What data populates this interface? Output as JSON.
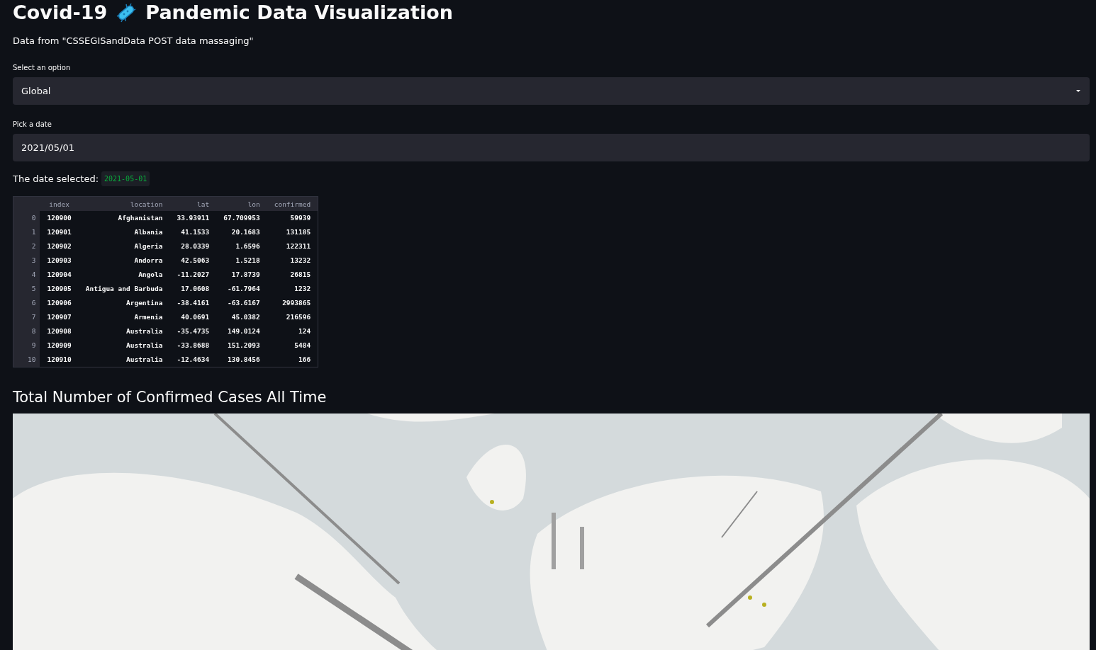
{
  "title": {
    "before_icon": "Covid-19",
    "after_icon": "Pandemic Data Visualization"
  },
  "source_note": "Data from \"CSSEGISandData POST data massaging\"",
  "select": {
    "label": "Select an option",
    "value": "Global"
  },
  "date_input": {
    "label": "Pick a date",
    "value": "2021/05/01"
  },
  "date_selected": {
    "label": "The date selected:",
    "value": "2021-05-01"
  },
  "table": {
    "columns": [
      "index",
      "location",
      "lat",
      "lon",
      "confirmed"
    ],
    "rows": [
      {
        "row_index": "0",
        "cells": [
          "120900",
          "Afghanistan",
          "33.93911",
          "67.709953",
          "59939"
        ]
      },
      {
        "row_index": "1",
        "cells": [
          "120901",
          "Albania",
          "41.1533",
          "20.1683",
          "131185"
        ]
      },
      {
        "row_index": "2",
        "cells": [
          "120902",
          "Algeria",
          "28.0339",
          "1.6596",
          "122311"
        ]
      },
      {
        "row_index": "3",
        "cells": [
          "120903",
          "Andorra",
          "42.5063",
          "1.5218",
          "13232"
        ]
      },
      {
        "row_index": "4",
        "cells": [
          "120904",
          "Angola",
          "-11.2027",
          "17.8739",
          "26815"
        ]
      },
      {
        "row_index": "5",
        "cells": [
          "120905",
          "Antigua and Barbuda",
          "17.0608",
          "-61.7964",
          "1232"
        ]
      },
      {
        "row_index": "6",
        "cells": [
          "120906",
          "Argentina",
          "-38.4161",
          "-63.6167",
          "2993865"
        ]
      },
      {
        "row_index": "7",
        "cells": [
          "120907",
          "Armenia",
          "40.0691",
          "45.0382",
          "216596"
        ]
      },
      {
        "row_index": "8",
        "cells": [
          "120908",
          "Australia",
          "-35.4735",
          "149.0124",
          "124"
        ]
      },
      {
        "row_index": "9",
        "cells": [
          "120909",
          "Australia",
          "-33.8688",
          "151.2093",
          "5484"
        ]
      },
      {
        "row_index": "10",
        "cells": [
          "120910",
          "Australia",
          "-12.4634",
          "130.8456",
          "166"
        ]
      }
    ]
  },
  "map_section": {
    "heading": "Total Number of Confirmed Cases All Time"
  }
}
